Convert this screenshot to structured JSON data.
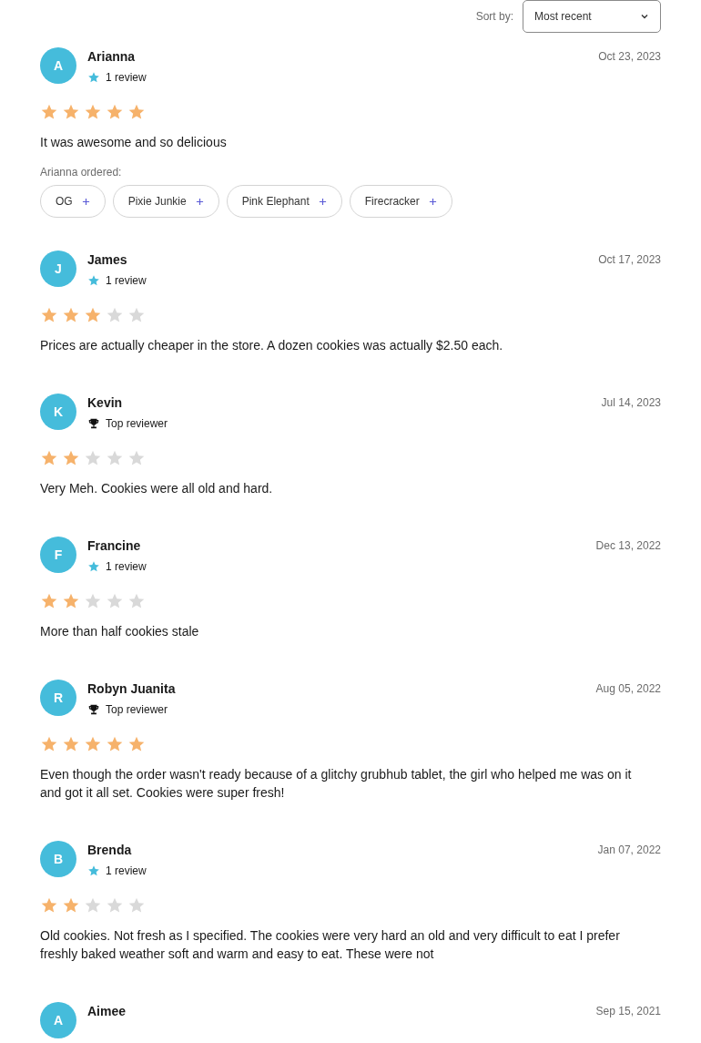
{
  "sort": {
    "label": "Sort by:",
    "value": "Most recent"
  },
  "reviews": [
    {
      "initial": "A",
      "name": "Arianna",
      "badge": {
        "kind": "reviews",
        "text": "1 review"
      },
      "date": "Oct 23, 2023",
      "stars": 5,
      "text": "It was awesome and so delicious",
      "ordered": {
        "label": "Arianna ordered:",
        "items": [
          "OG",
          "Pixie Junkie",
          "Pink Elephant",
          "Firecracker"
        ]
      }
    },
    {
      "initial": "J",
      "name": "James",
      "badge": {
        "kind": "reviews",
        "text": "1 review"
      },
      "date": "Oct 17, 2023",
      "stars": 3,
      "text": "Prices are actually cheaper in the store. A dozen cookies was actually $2.50 each."
    },
    {
      "initial": "K",
      "name": "Kevin",
      "badge": {
        "kind": "top",
        "text": "Top reviewer"
      },
      "date": "Jul 14, 2023",
      "stars": 2,
      "text": "Very Meh. Cookies were all old and hard."
    },
    {
      "initial": "F",
      "name": "Francine",
      "badge": {
        "kind": "reviews",
        "text": "1 review"
      },
      "date": "Dec 13, 2022",
      "stars": 2,
      "text": "More than half cookies stale"
    },
    {
      "initial": "R",
      "name": "Robyn Juanita",
      "badge": {
        "kind": "top",
        "text": "Top reviewer"
      },
      "date": "Aug 05, 2022",
      "stars": 5,
      "text": "Even though the order wasn't ready because of a glitchy grubhub tablet, the girl who helped me was on it and got it all set. Cookies were super fresh!"
    },
    {
      "initial": "B",
      "name": "Brenda",
      "badge": {
        "kind": "reviews",
        "text": "1 review"
      },
      "date": "Jan 07, 2022",
      "stars": 2,
      "text": "Old cookies. Not fresh as I specified. The cookies were very hard an old and very difficult to eat I prefer freshly baked weather soft and warm and easy to eat. These were not"
    },
    {
      "initial": "A",
      "name": "Aimee",
      "date": "Sep 15, 2021"
    }
  ]
}
